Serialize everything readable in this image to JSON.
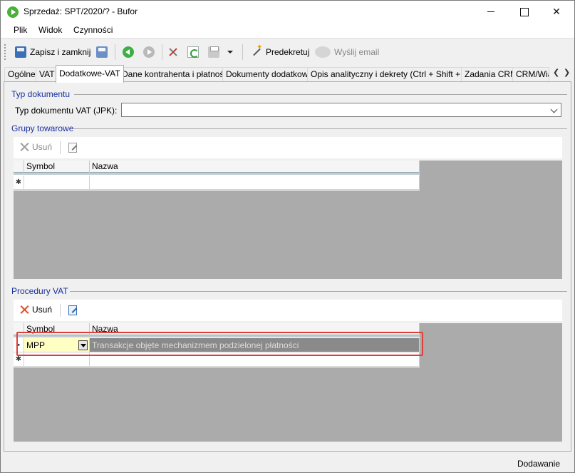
{
  "window": {
    "title": "Sprzedaż: SPT/2020/? - Bufor",
    "minimize": "",
    "maximize": "",
    "close": "✕"
  },
  "menu": {
    "items": [
      "Plik",
      "Widok",
      "Czynności"
    ]
  },
  "toolbar": {
    "save_close": "Zapisz i zamknij",
    "predekretuj": "Predekretuj",
    "send_email": "Wyślij email"
  },
  "tabs": [
    "Ogólne",
    "VAT",
    "Dodatkowe-VAT",
    "Dane kontrahenta i płatności",
    "Dokumenty dodatkowe",
    "Opis analityczny i dekrety (Ctrl + Shift + D)",
    "Zadania CRM",
    "CRM/Wia"
  ],
  "active_tab": "Dodatkowe-VAT",
  "doc_type": {
    "group_title": "Typ dokumentu",
    "label": "Typ dokumentu VAT (JPK):",
    "value": ""
  },
  "product_groups": {
    "group_title": "Grupy towarowe",
    "remove_label": "Usuń",
    "columns": [
      "Symbol",
      "Nazwa"
    ],
    "new_row_marker": "✱"
  },
  "vat_procedures": {
    "group_title": "Procedury VAT",
    "remove_label": "Usuń",
    "columns": [
      "Symbol",
      "Nazwa"
    ],
    "rows": [
      {
        "indicator": "▸",
        "symbol": "MPP",
        "name": "Transakcje objęte mechanizmem podzielonej płatności"
      }
    ],
    "new_row_marker": "✱"
  },
  "status": {
    "text": "Dodawanie"
  },
  "colors": {
    "group_title": "#1a2fa0",
    "highlight": "#e0403a",
    "selected_cell": "#ffffc4"
  },
  "icons": [
    "save-icon",
    "save-disk-icon",
    "back-icon",
    "forward-icon",
    "tools-icon",
    "refresh-icon",
    "print-icon",
    "wand-icon",
    "email-icon",
    "remove-icon",
    "edit-icon"
  ]
}
